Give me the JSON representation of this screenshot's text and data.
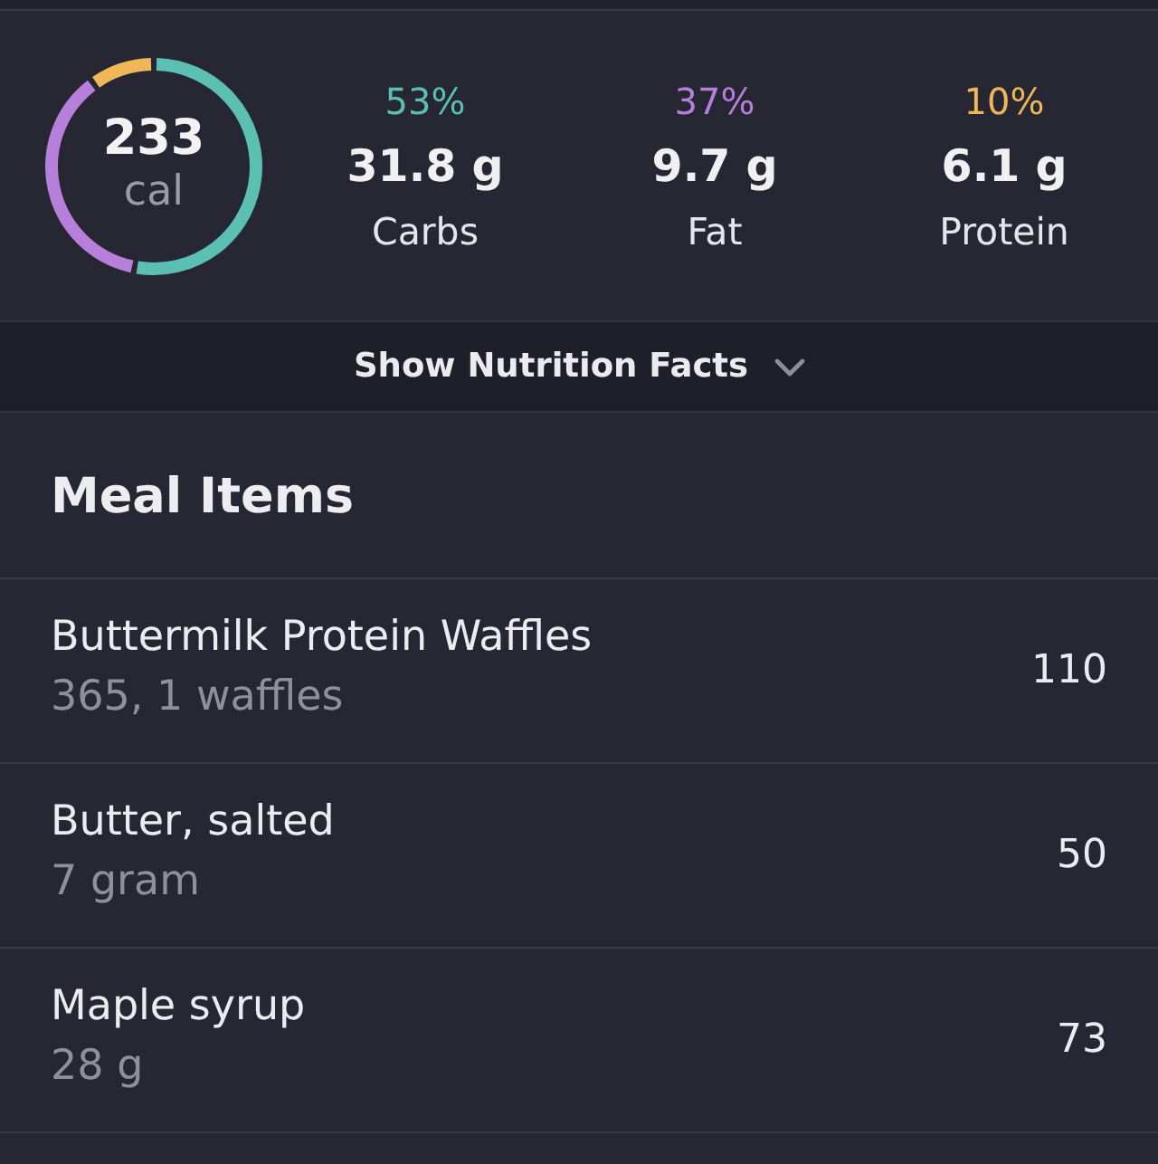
{
  "summary": {
    "calories": "233",
    "calories_unit": "cal",
    "macros": [
      {
        "percent": "53%",
        "amount": "31.8 g",
        "name": "Carbs",
        "color": "#5cbfb4",
        "level": 0.53
      },
      {
        "percent": "37%",
        "amount": "9.7 g",
        "name": "Fat",
        "color": "#b67fda",
        "level": 0.37
      },
      {
        "percent": "10%",
        "amount": "6.1 g",
        "name": "Protein",
        "color": "#f0b65a",
        "level": 0.1
      }
    ]
  },
  "nutrition_toggle": {
    "label": "Show Nutrition Facts",
    "expanded": false
  },
  "meal_items": {
    "title": "Meal Items",
    "items": [
      {
        "name": "Buttermilk Protein Waffles",
        "serving": "365, 1 waffles",
        "calories": "110"
      },
      {
        "name": "Butter, salted",
        "serving": "7 gram",
        "calories": "50"
      },
      {
        "name": "Maple syrup",
        "serving": "28 g",
        "calories": "73"
      }
    ]
  }
}
